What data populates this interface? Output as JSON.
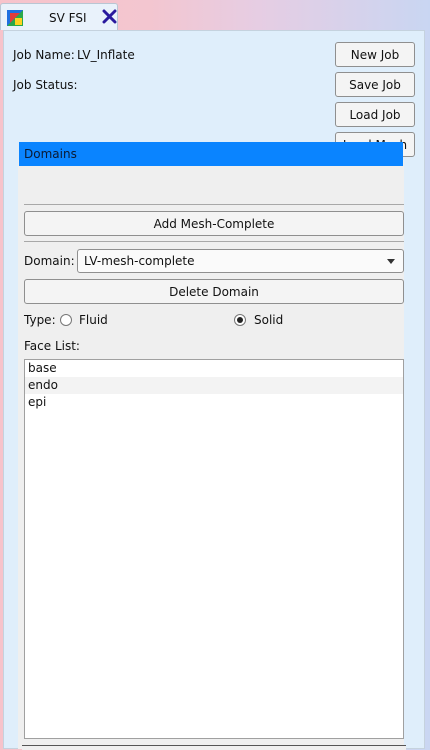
{
  "tab": {
    "title": "SV FSI",
    "icon": "sv-fsi-logo-icon",
    "close_icon": "close-x-icon"
  },
  "job": {
    "name_label": "Job Name:",
    "name_value": "LV_Inflate",
    "status_label": "Job Status:",
    "status_value": ""
  },
  "buttons": {
    "new_job": "New Job",
    "save_job": "Save Job",
    "load_job": "Load Job",
    "load_mesh": "Load Mesh"
  },
  "domains": {
    "header": "Domains",
    "add_button": "Add Mesh-Complete",
    "domain_label": "Domain:",
    "domain_selected": "LV-mesh-complete",
    "delete_button": "Delete Domain",
    "type_label": "Type:",
    "type_options": [
      "Fluid",
      "Solid"
    ],
    "type_selected": "Solid",
    "face_list_label": "Face List:",
    "faces": [
      "base",
      "endo",
      "epi"
    ]
  },
  "colors": {
    "header_blue": "#0a84ff",
    "panel_bg": "#dfeefb",
    "close_x": "#2a1a9e"
  }
}
